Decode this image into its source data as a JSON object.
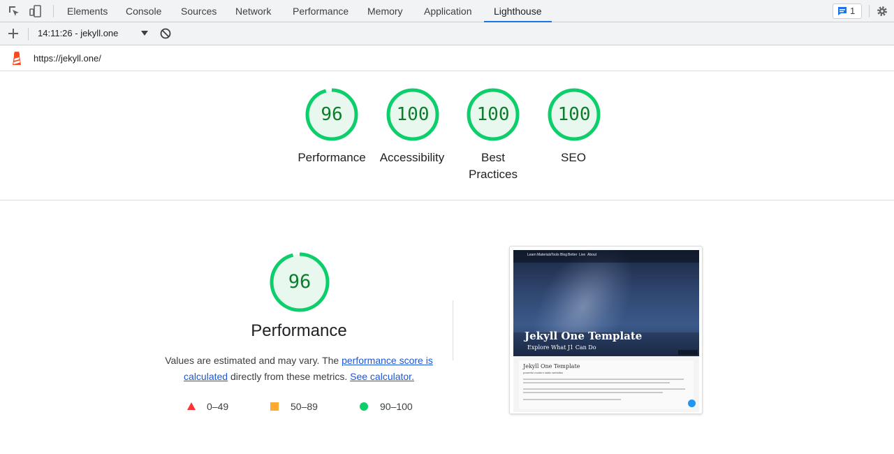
{
  "devtools": {
    "tabs": [
      "Elements",
      "Console",
      "Sources",
      "Network",
      "Performance",
      "Memory",
      "Application",
      "Lighthouse"
    ],
    "active_tab": "Lighthouse",
    "issues_count": "1"
  },
  "toolbar": {
    "report": "14:11:26 - jekyll.one"
  },
  "url": "https://jekyll.one/",
  "scores": [
    {
      "label": "Performance",
      "value": "96"
    },
    {
      "label": "Accessibility",
      "value": "100"
    },
    {
      "label": "Best Practices",
      "label_line1": "Best",
      "label_line2": "Practices",
      "value": "100"
    },
    {
      "label": "SEO",
      "value": "100"
    }
  ],
  "performance": {
    "score": "96",
    "title": "Performance",
    "desc_prefix": "Values are estimated and may vary. The ",
    "link1": "performance score is calculated",
    "desc_middle": " directly from these metrics. ",
    "link2": "See calculator."
  },
  "legend": [
    {
      "range": "0–49",
      "color": "#ff3333",
      "shape": "triangle"
    },
    {
      "range": "50–89",
      "color": "#ffaa33",
      "shape": "square"
    },
    {
      "range": "90–100",
      "color": "#0cce6b",
      "shape": "circle"
    }
  ],
  "screenshot": {
    "hero_title": "Jekyll One Template",
    "hero_subtitle": "Explore What J1 Can Do",
    "card_title": "Jekyll One Template",
    "card_subtitle": "powerful modern static websites",
    "nav_items": [
      "Learn",
      "Materials",
      "Tools",
      "Blog",
      "Better",
      "Live",
      "About"
    ]
  },
  "colors": {
    "pass": "#0cce6b",
    "pass_text": "#0c7d2b",
    "pass_fill": "#e8f8ee",
    "accent": "#1a73e8"
  }
}
